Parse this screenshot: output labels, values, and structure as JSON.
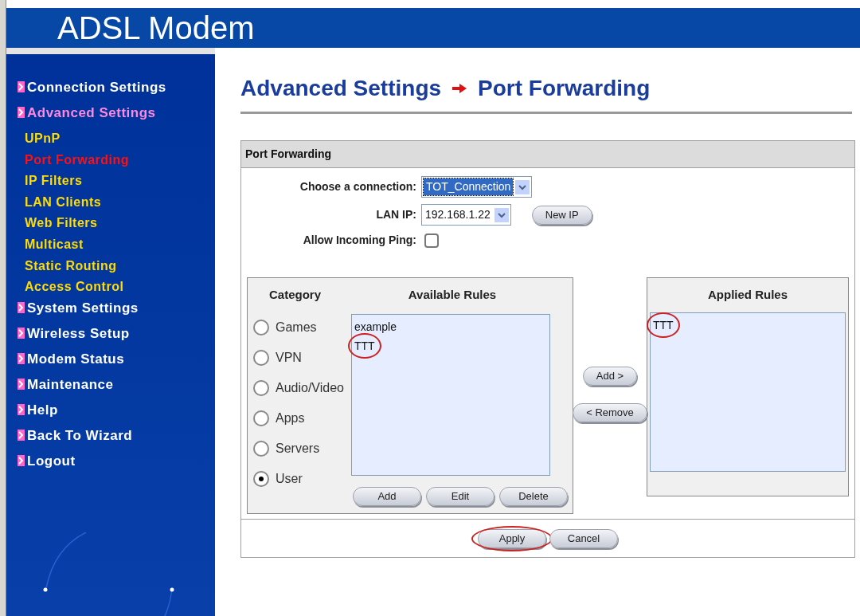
{
  "header": {
    "title": "ADSL Modem"
  },
  "sidebar": {
    "items": [
      {
        "kind": "section",
        "label": "Connection Settings",
        "expanded": false
      },
      {
        "kind": "section",
        "label": "Advanced Settings",
        "expanded": true
      },
      {
        "kind": "link",
        "label": "UPnP",
        "selected": false
      },
      {
        "kind": "link",
        "label": "Port Forwarding",
        "selected": true
      },
      {
        "kind": "link",
        "label": "IP Filters",
        "selected": false
      },
      {
        "kind": "link",
        "label": "LAN Clients",
        "selected": false
      },
      {
        "kind": "link",
        "label": "Web Filters",
        "selected": false
      },
      {
        "kind": "link",
        "label": "Multicast",
        "selected": false
      },
      {
        "kind": "link",
        "label": "Static Routing",
        "selected": false
      },
      {
        "kind": "link",
        "label": "Access Control",
        "selected": false
      },
      {
        "kind": "section",
        "label": "System Settings",
        "expanded": false
      },
      {
        "kind": "section",
        "label": "Wireless Setup",
        "expanded": false
      },
      {
        "kind": "section",
        "label": "Modem Status",
        "expanded": false
      },
      {
        "kind": "section",
        "label": "Maintenance",
        "expanded": false
      },
      {
        "kind": "section",
        "label": "Help",
        "expanded": false
      },
      {
        "kind": "section",
        "label": "Back To Wizard",
        "expanded": false
      },
      {
        "kind": "section",
        "label": "Logout",
        "expanded": false
      }
    ]
  },
  "breadcrumb": [
    "Advanced Settings",
    "Port Forwarding"
  ],
  "panel": {
    "title": "Port Forwarding",
    "connection": {
      "label": "Choose a connection:",
      "value": "TOT_Connection"
    },
    "lan_ip": {
      "label": "LAN IP:",
      "value": "192.168.1.22",
      "button": "New IP"
    },
    "ping": {
      "label": "Allow Incoming Ping:",
      "checked": false
    },
    "category": {
      "heading": "Category",
      "options": [
        {
          "label": "Games",
          "selected": false
        },
        {
          "label": "VPN",
          "selected": false
        },
        {
          "label": "Audio/Video",
          "selected": false
        },
        {
          "label": "Apps",
          "selected": false
        },
        {
          "label": "Servers",
          "selected": false
        },
        {
          "label": "User",
          "selected": true
        }
      ]
    },
    "available": {
      "heading": "Available Rules",
      "items": [
        {
          "label": "example",
          "circled": false
        },
        {
          "label": "TTT",
          "circled": true
        }
      ],
      "buttons": [
        "Add",
        "Edit",
        "Delete"
      ]
    },
    "move_buttons": [
      "Add >",
      "< Remove"
    ],
    "applied": {
      "heading": "Applied Rules",
      "items": [
        {
          "label": "TTT",
          "circled": true
        }
      ]
    },
    "actions": [
      {
        "label": "Apply",
        "circled": true
      },
      {
        "label": "Cancel",
        "circled": false
      }
    ]
  }
}
